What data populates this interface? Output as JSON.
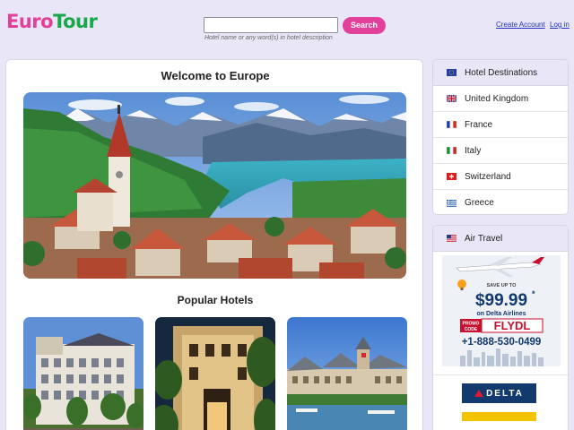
{
  "header": {
    "logo_part1": "Euro",
    "logo_part2": "Tour",
    "search": {
      "value": "",
      "placeholder": "",
      "button": "Search",
      "hint": "Hotel name or any word(s) in hotel description"
    },
    "links": {
      "create_account": "Create Account",
      "login": "Log in"
    }
  },
  "main": {
    "title": "Welcome to Europe",
    "popular_title": "Popular Hotels"
  },
  "sidebar": {
    "destinations_heading": "Hotel Destinations",
    "destinations": [
      {
        "label": "United Kingdom",
        "flag": "uk-flag-icon"
      },
      {
        "label": "France",
        "flag": "france-flag-icon"
      },
      {
        "label": "Italy",
        "flag": "italy-flag-icon"
      },
      {
        "label": "Switzerland",
        "flag": "switzerland-flag-icon"
      },
      {
        "label": "Greece",
        "flag": "greece-flag-icon"
      }
    ],
    "air_heading": "Air Travel",
    "ad": {
      "save_text": "SAVE UP TO",
      "price": "$99.99",
      "asterisk": "*",
      "airline_text": "on Delta Airlines",
      "promo_label1": "PROMO",
      "promo_label2": "CODE",
      "promo_code": "FLYDL",
      "phone": "+1-888-530-0499"
    },
    "delta_logo": "DELTA"
  },
  "colors": {
    "brand_pink": "#e2409a",
    "brand_green": "#18a84a",
    "link_blue": "#2230c8",
    "background": "#e9e6f7"
  }
}
